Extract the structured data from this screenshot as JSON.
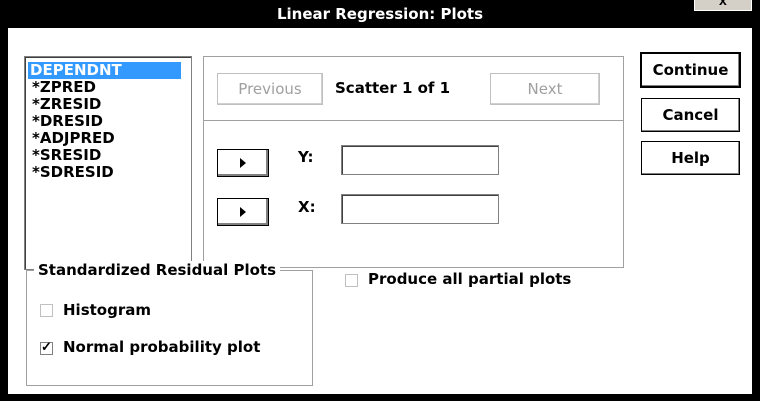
{
  "window": {
    "title": "Linear Regression: Plots",
    "close_label": "x"
  },
  "variables": {
    "items": [
      "DEPENDNT",
      "*ZPRED",
      "*ZRESID",
      "*DRESID",
      "*ADJPRED",
      "*SRESID",
      "*SDRESID"
    ],
    "selected_index": 0
  },
  "scatter": {
    "previous_label": "Previous",
    "counter": "Scatter 1 of 1",
    "next_label": "Next",
    "y_label": "Y:",
    "x_label": "X:",
    "y_value": "",
    "x_value": ""
  },
  "buttons": {
    "continue": "Continue",
    "cancel": "Cancel",
    "help": "Help"
  },
  "residual_plots": {
    "title": "Standardized Residual Plots",
    "histogram": {
      "label": "Histogram",
      "checked": false
    },
    "normal_probability": {
      "label": "Normal probability plot",
      "checked": true
    }
  },
  "partial_plots": {
    "label": "Produce all partial plots",
    "checked": false
  },
  "icons": {
    "move_arrow": "right-arrow-icon",
    "check": "checkmark-icon"
  }
}
